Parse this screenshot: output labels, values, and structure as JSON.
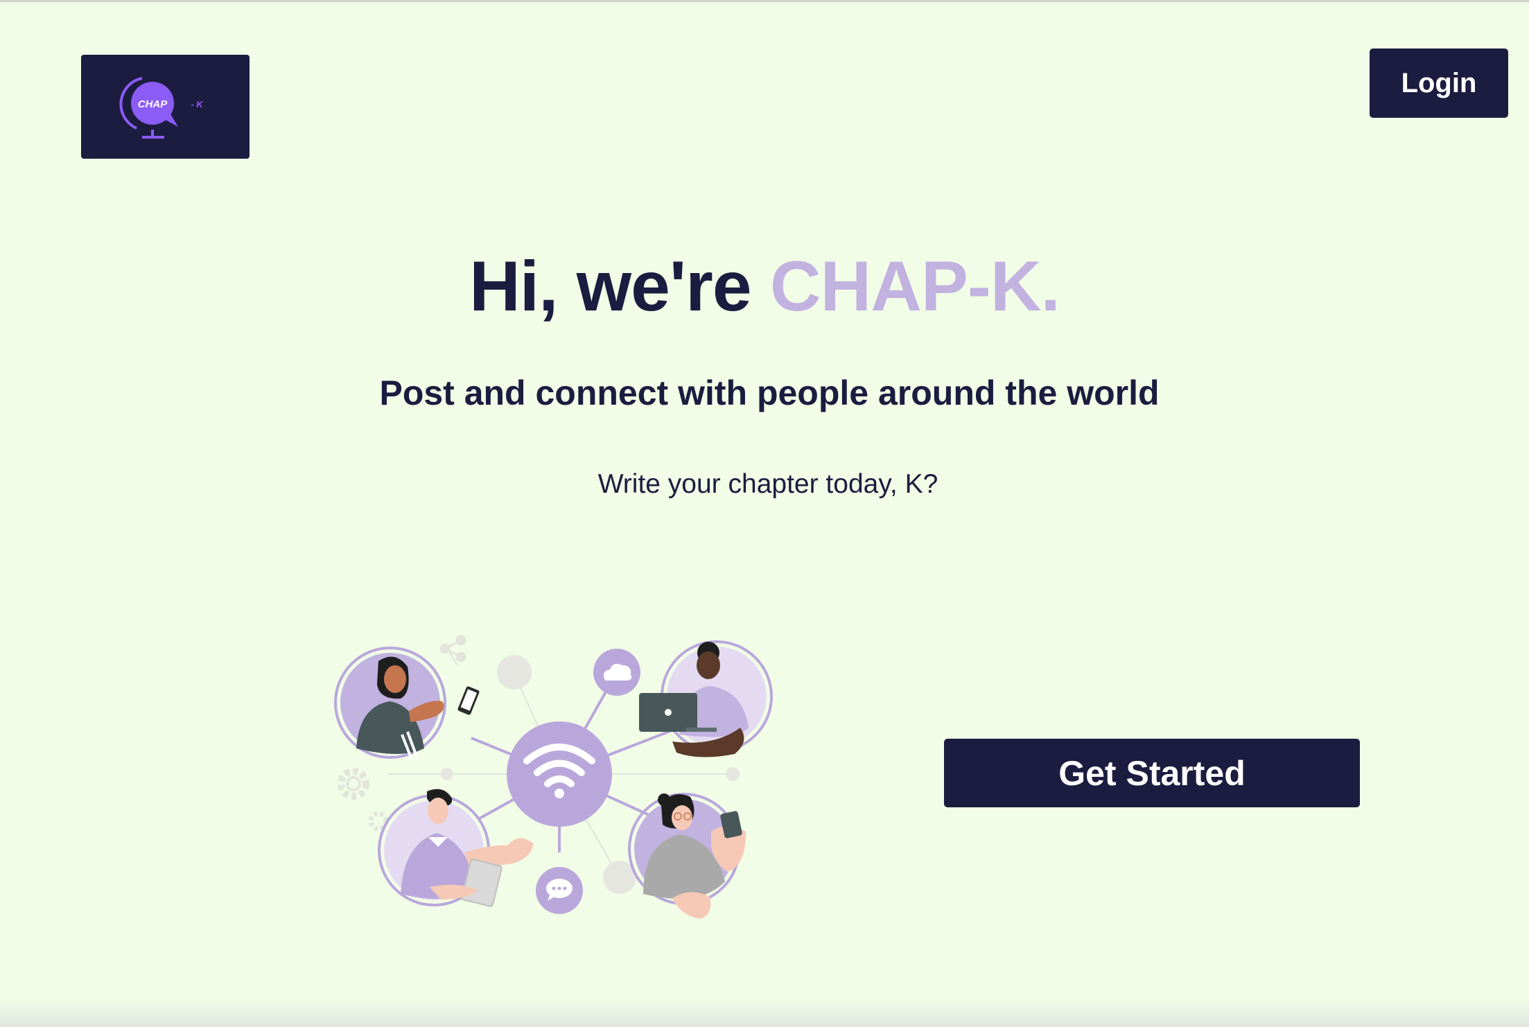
{
  "header": {
    "logo": {
      "text": "CHAP",
      "suffix": "- K",
      "icon": "globe-chat-icon"
    },
    "login_label": "Login"
  },
  "hero": {
    "title_prefix": "Hi, we're ",
    "title_brand": "CHAP-K.",
    "subtitle": "Post and connect with people around the world",
    "tagline": "Write your chapter today, K?"
  },
  "cta": {
    "label": "Get Started"
  },
  "illustration": {
    "center_icon": "wifi-icon",
    "nodes": [
      "cloud-icon",
      "chat-bubble-icon",
      "share-icon",
      "gear-icon"
    ],
    "people": [
      "person-with-phone",
      "person-with-laptop",
      "person-with-tablet",
      "person-with-smartphone"
    ]
  },
  "colors": {
    "background": "#f1fde6",
    "navy": "#1c1c40",
    "brand_lavender": "#c1b2e0",
    "accent_purple": "#8b5cf6",
    "illustration_purple": "#b9a7dc"
  }
}
